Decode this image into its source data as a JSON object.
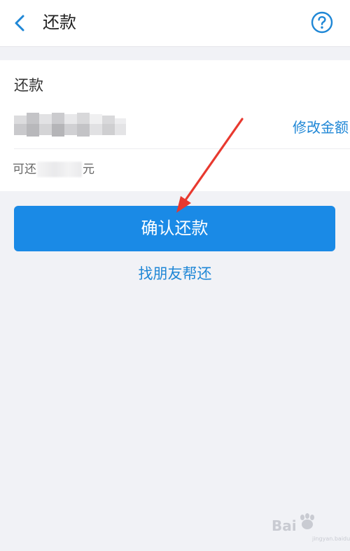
{
  "header": {
    "title": "还款",
    "back_icon": "chevron-left-icon",
    "help_icon": "question-circle-icon"
  },
  "card": {
    "title": "还款",
    "edit_amount_label": "修改金额",
    "available_prefix": "可还",
    "available_suffix": "元"
  },
  "actions": {
    "confirm_label": "确认还款",
    "friend_help_label": "找朋友帮还"
  },
  "overlay": {
    "arrow_color": "#e8392f"
  },
  "watermark": {
    "text": "Bai",
    "sub": "jingyan.baidu.com"
  },
  "colors": {
    "accent": "#1a8ae6",
    "link": "#1f87d6",
    "background": "#f1f2f6"
  }
}
